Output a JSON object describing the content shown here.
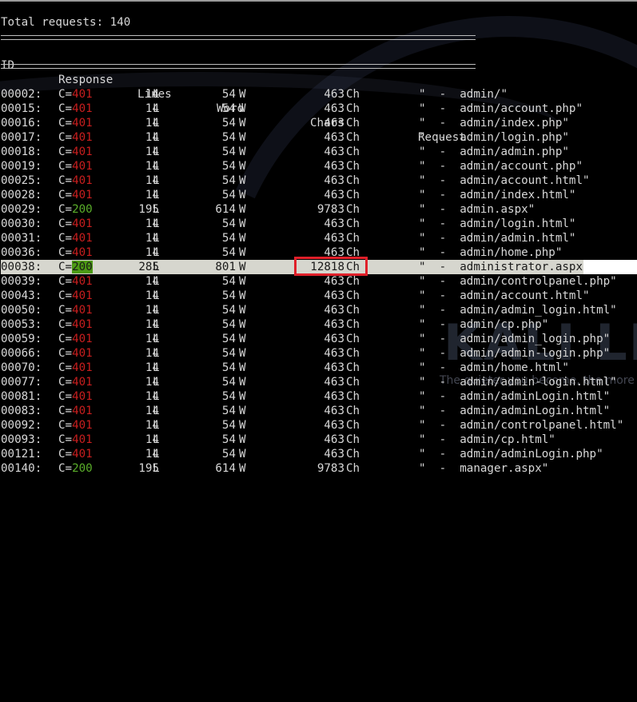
{
  "terminal": {
    "total_requests_label": "Total requests: 140",
    "separator": "=================================================================================",
    "headers": {
      "id": "ID",
      "response": "Response",
      "lines": "Lines",
      "word": "Word",
      "chars": "Chars",
      "request": "Request"
    },
    "rows": [
      {
        "id": "00002:",
        "code_prefix": "C=",
        "code": "401",
        "lines": "14",
        "word": "54",
        "chars": "463",
        "request": "\"  -  admin/\""
      },
      {
        "id": "00015:",
        "code_prefix": "C=",
        "code": "401",
        "lines": "14",
        "word": "54",
        "chars": "463",
        "request": "\"  -  admin/account.php\""
      },
      {
        "id": "00016:",
        "code_prefix": "C=",
        "code": "401",
        "lines": "14",
        "word": "54",
        "chars": "463",
        "request": "\"  -  admin/index.php\""
      },
      {
        "id": "00017:",
        "code_prefix": "C=",
        "code": "401",
        "lines": "14",
        "word": "54",
        "chars": "463",
        "request": "\"  -  admin/login.php\""
      },
      {
        "id": "00018:",
        "code_prefix": "C=",
        "code": "401",
        "lines": "14",
        "word": "54",
        "chars": "463",
        "request": "\"  -  admin/admin.php\""
      },
      {
        "id": "00019:",
        "code_prefix": "C=",
        "code": "401",
        "lines": "14",
        "word": "54",
        "chars": "463",
        "request": "\"  -  admin/account.php\""
      },
      {
        "id": "00025:",
        "code_prefix": "C=",
        "code": "401",
        "lines": "14",
        "word": "54",
        "chars": "463",
        "request": "\"  -  admin/account.html\""
      },
      {
        "id": "00028:",
        "code_prefix": "C=",
        "code": "401",
        "lines": "14",
        "word": "54",
        "chars": "463",
        "request": "\"  -  admin/index.html\""
      },
      {
        "id": "00029:",
        "code_prefix": "C=",
        "code": "200",
        "lines": "195",
        "word": "614",
        "chars": "9783",
        "request": "\"  -  admin.aspx\""
      },
      {
        "id": "00030:",
        "code_prefix": "C=",
        "code": "401",
        "lines": "14",
        "word": "54",
        "chars": "463",
        "request": "\"  -  admin/login.html\""
      },
      {
        "id": "00031:",
        "code_prefix": "C=",
        "code": "401",
        "lines": "14",
        "word": "54",
        "chars": "463",
        "request": "\"  -  admin/admin.html\""
      },
      {
        "id": "00036:",
        "code_prefix": "C=",
        "code": "401",
        "lines": "14",
        "word": "54",
        "chars": "463",
        "request": "\"  -  admin/home.php\""
      },
      {
        "id": "00038:",
        "code_prefix": "C=",
        "code": "200",
        "lines": "285",
        "word": "801",
        "chars": "12818",
        "request": "\"  -  administrator.aspx\"",
        "highlighted": true
      },
      {
        "id": "00039:",
        "code_prefix": "C=",
        "code": "401",
        "lines": "14",
        "word": "54",
        "chars": "463",
        "request": "\"  -  admin/controlpanel.php\""
      },
      {
        "id": "00043:",
        "code_prefix": "C=",
        "code": "401",
        "lines": "14",
        "word": "54",
        "chars": "463",
        "request": "\"  -  admin/account.html\""
      },
      {
        "id": "00050:",
        "code_prefix": "C=",
        "code": "401",
        "lines": "14",
        "word": "54",
        "chars": "463",
        "request": "\"  -  admin/admin_login.html\""
      },
      {
        "id": "00053:",
        "code_prefix": "C=",
        "code": "401",
        "lines": "14",
        "word": "54",
        "chars": "463",
        "request": "\"  -  admin/cp.php\""
      },
      {
        "id": "00059:",
        "code_prefix": "C=",
        "code": "401",
        "lines": "14",
        "word": "54",
        "chars": "463",
        "request": "\"  -  admin/admin_login.php\""
      },
      {
        "id": "00066:",
        "code_prefix": "C=",
        "code": "401",
        "lines": "14",
        "word": "54",
        "chars": "463",
        "request": "\"  -  admin/admin-login.php\""
      },
      {
        "id": "00070:",
        "code_prefix": "C=",
        "code": "401",
        "lines": "14",
        "word": "54",
        "chars": "463",
        "request": "\"  -  admin/home.html\""
      },
      {
        "id": "00077:",
        "code_prefix": "C=",
        "code": "401",
        "lines": "14",
        "word": "54",
        "chars": "463",
        "request": "\"  -  admin/admin-login.html\""
      },
      {
        "id": "00081:",
        "code_prefix": "C=",
        "code": "401",
        "lines": "14",
        "word": "54",
        "chars": "463",
        "request": "\"  -  admin/adminLogin.html\""
      },
      {
        "id": "00083:",
        "code_prefix": "C=",
        "code": "401",
        "lines": "14",
        "word": "54",
        "chars": "463",
        "request": "\"  -  admin/adminLogin.html\""
      },
      {
        "id": "00092:",
        "code_prefix": "C=",
        "code": "401",
        "lines": "14",
        "word": "54",
        "chars": "463",
        "request": "\"  -  admin/controlpanel.html\""
      },
      {
        "id": "00093:",
        "code_prefix": "C=",
        "code": "401",
        "lines": "14",
        "word": "54",
        "chars": "463",
        "request": "\"  -  admin/cp.html\""
      },
      {
        "id": "00121:",
        "code_prefix": "C=",
        "code": "401",
        "lines": "14",
        "word": "54",
        "chars": "463",
        "request": "\"  -  admin/adminLogin.php\""
      },
      {
        "id": "00140:",
        "code_prefix": "C=",
        "code": "200",
        "lines": "195",
        "word": "614",
        "chars": "9783",
        "request": "\"  -  manager.aspx\""
      }
    ],
    "units": {
      "lines": "L",
      "word": "W",
      "chars": "Ch"
    },
    "colors": {
      "code_401": "#c81e1e",
      "code_200": "#5aae2a",
      "highlight_box": "#e0202a",
      "highlight_row": "#d6d6ce"
    }
  },
  "wallpaper": {
    "logo_text": "KALI LINUX",
    "tagline": "The quieter you become, the more you are able to hear"
  }
}
